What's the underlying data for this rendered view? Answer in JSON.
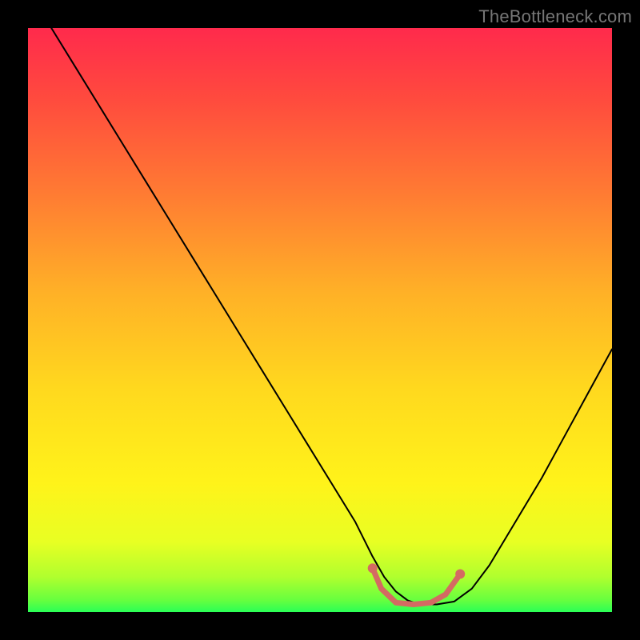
{
  "watermark": "TheBottleneck.com",
  "chart_data": {
    "type": "line",
    "title": "",
    "xlabel": "",
    "ylabel": "",
    "xlim": [
      0,
      100
    ],
    "ylim": [
      0,
      100
    ],
    "background_gradient": {
      "top_color": "#ff2a4c",
      "middle_color": "#ffe11a",
      "bottom_color": "#29ff56"
    },
    "series": [
      {
        "name": "curve",
        "type": "line",
        "color": "#000000",
        "x": [
          4,
          8,
          12,
          16,
          20,
          24,
          28,
          32,
          36,
          40,
          44,
          48,
          52,
          56,
          59,
          61,
          63,
          65,
          67,
          70,
          73,
          76,
          79,
          82,
          85,
          88,
          91,
          94,
          97,
          100
        ],
        "y": [
          100,
          93.5,
          87,
          80.5,
          74,
          67.5,
          61,
          54.5,
          48,
          41.5,
          35,
          28.5,
          22,
          15.5,
          9.5,
          6,
          3.5,
          2,
          1.3,
          1.3,
          1.8,
          4,
          8,
          13,
          18,
          23,
          28.5,
          34,
          39.5,
          45
        ]
      },
      {
        "name": "optimal-range",
        "type": "line",
        "color": "#d46a62",
        "stroke_width": 7,
        "x": [
          59,
          60.5,
          63,
          66,
          69,
          71.5,
          74
        ],
        "y": [
          7.5,
          4.0,
          1.6,
          1.3,
          1.6,
          3.0,
          6.5
        ]
      },
      {
        "name": "optimal-endpoints",
        "type": "scatter",
        "color": "#d46a62",
        "x": [
          59,
          74
        ],
        "y": [
          7.5,
          6.5
        ]
      }
    ]
  }
}
